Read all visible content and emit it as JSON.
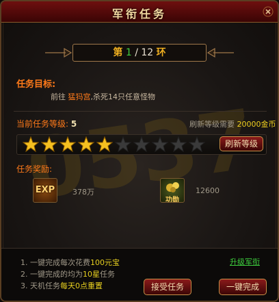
{
  "window": {
    "title": "军衔任务"
  },
  "ring": {
    "prefix": "第",
    "current": "1",
    "separator": "/",
    "total": "12",
    "suffix": "环"
  },
  "goal": {
    "heading": "任务目标:",
    "text_before": "前往",
    "location": "猛犸宫",
    "text_after": ",杀死14只任意怪物"
  },
  "level": {
    "label": "当前任务等级:",
    "value": "5",
    "refresh_cost_label": "刷新等级需要",
    "refresh_cost_value": "20000金币",
    "stars_filled": 5,
    "stars_total": 10,
    "refresh_button": "刷新等级"
  },
  "reward": {
    "heading": "任务奖励:",
    "exp_icon_text": "EXP",
    "exp_value": "378万",
    "merit_icon_text": "功勋",
    "merit_value": "12600"
  },
  "notes": [
    {
      "num": "1.",
      "before": "一键完成每次花费",
      "highlight": "100元宝",
      "after": ""
    },
    {
      "num": "2.",
      "before": "一键完成的均为",
      "highlight": "10星",
      "after": "任务"
    },
    {
      "num": "3.",
      "before": "天机任务",
      "highlight": "每天0点重置",
      "after": ""
    }
  ],
  "upgrade_link": "升级军衔",
  "buttons": {
    "accept": "接受任务",
    "complete": "一键完成"
  },
  "watermark_text": "0537",
  "colors": {
    "accent_orange": "#ff7a1a",
    "gold": "#f0b020",
    "green": "#3ed03e",
    "button_red": "#8a1a1a"
  }
}
